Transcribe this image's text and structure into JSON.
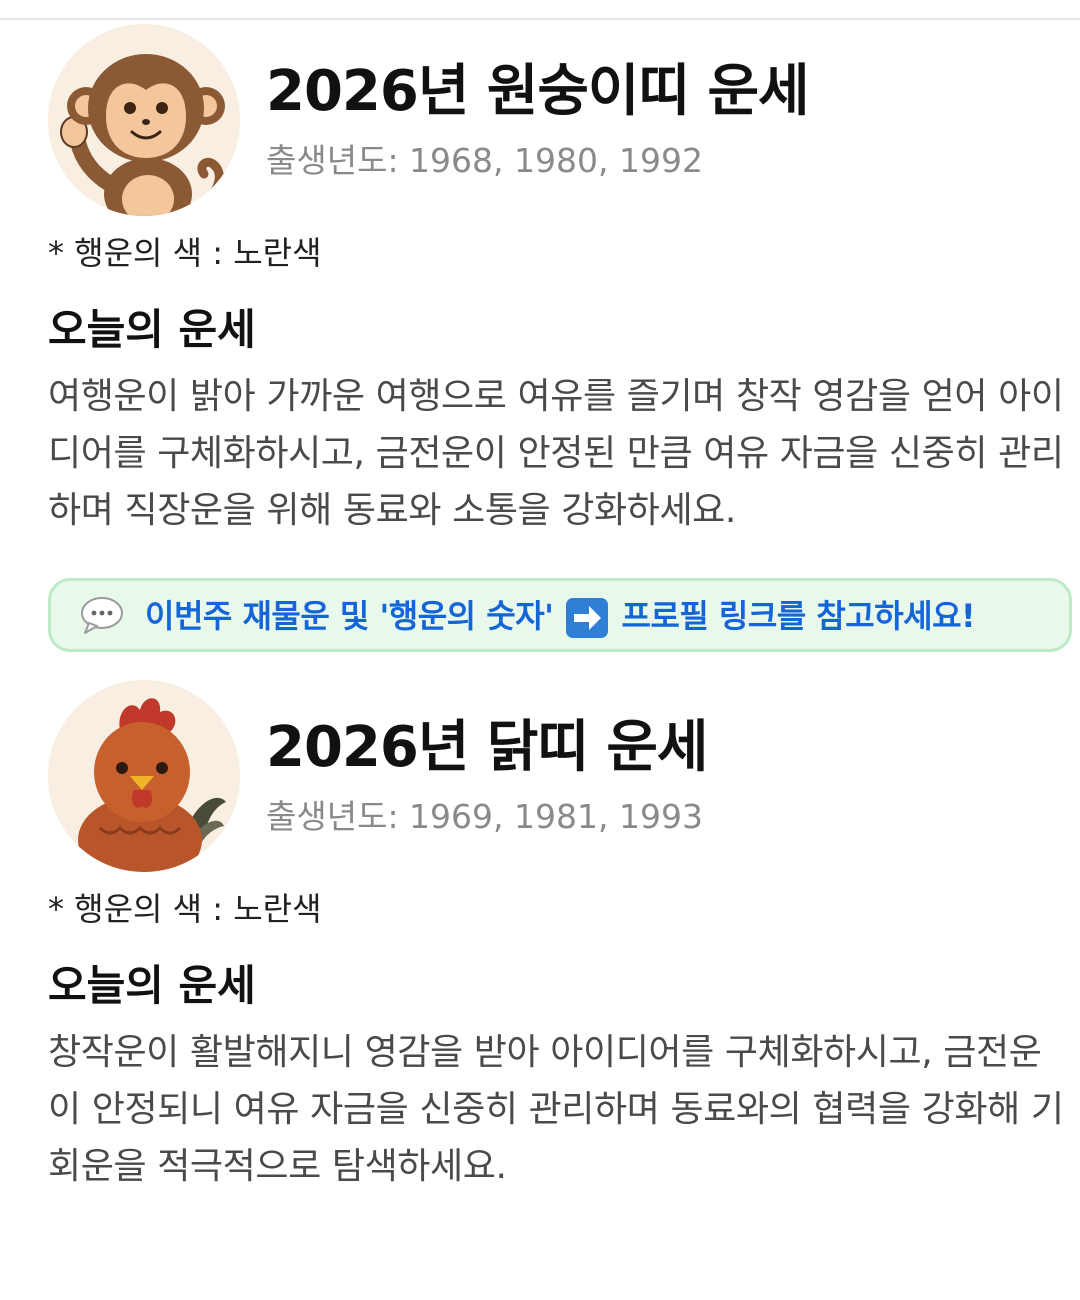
{
  "cards": [
    {
      "avatar_icon": "monkey-icon",
      "title": "2026년 원숭이띠 운세",
      "birth_years": "출생년도: 1968, 1980, 1992",
      "lucky_color": "* 행운의 색 : 노란색",
      "section_title": "오늘의 운세",
      "fortune": "여행운이 밝아 가까운 여행으로 여유를 즐기며 창작 영감을 얻어 아이디어를 구체화하시고, 금전운이 안정된 만큼 여유 자금을 신중히 관리하며 직장운을 위해 동료와 소통을 강화하세요."
    },
    {
      "avatar_icon": "rooster-icon",
      "title": "2026년 닭띠 운세",
      "birth_years": "출생년도: 1969, 1981, 1993",
      "lucky_color": "* 행운의 색 : 노란색",
      "section_title": "오늘의 운세",
      "fortune": "창작운이 활발해지니 영감을 받아 아이디어를 구체화하시고, 금전운이 안정되니 여유 자금을 신중히 관리하며 동료와의 협력을 강화해 기회운을 적극적으로 탐색하세요."
    }
  ],
  "banner": {
    "icon": "speech-bubble-icon",
    "text_before": "이번주 재물운 및 '행운의 숫자'",
    "arrow_icon": "right-arrow-icon",
    "text_after": "프로필 링크를 참고하세요!"
  },
  "colors": {
    "title": "#111111",
    "birth_years": "#8a8a8a",
    "body": "#4a4a4a",
    "banner_bg": "#e8f8ea",
    "banner_border": "#bfeac8",
    "banner_text": "#1565d8",
    "arrow_bg": "#2f7fd6"
  }
}
